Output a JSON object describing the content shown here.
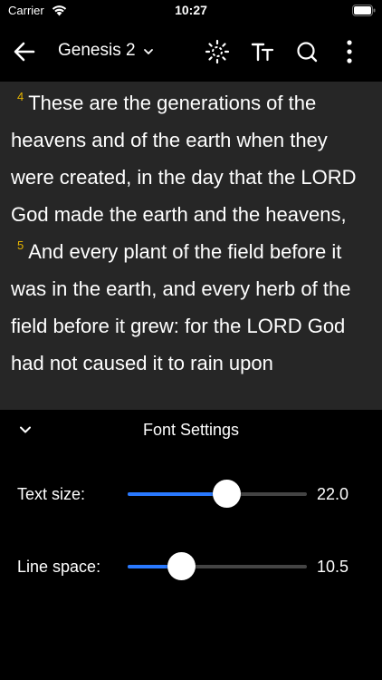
{
  "status_bar": {
    "carrier": "Carrier",
    "time": "10:27"
  },
  "header": {
    "title": "Genesis 2",
    "icons": [
      "back-icon",
      "chevron-down-icon",
      "brightness-icon",
      "font-size-icon",
      "search-icon",
      "more-icon"
    ]
  },
  "reader": {
    "verse_number_color": "#e6b400",
    "verses": [
      {
        "num": "4",
        "text": "These are the generations of the heavens and of the earth when they were created, in the day that the LORD God made the earth and the heavens,"
      },
      {
        "num": "5",
        "text": "And every plant of the field before it was in the earth, and every herb of the field before it grew: for the LORD God had not caused it to rain upon"
      }
    ]
  },
  "font_panel": {
    "title": "Font Settings",
    "accent_color": "#2979ff",
    "text_size": {
      "label": "Text size:",
      "value": "22.0",
      "level": 0.55
    },
    "line_space": {
      "label": "Line space:",
      "value": "10.5",
      "level": 0.3
    }
  }
}
